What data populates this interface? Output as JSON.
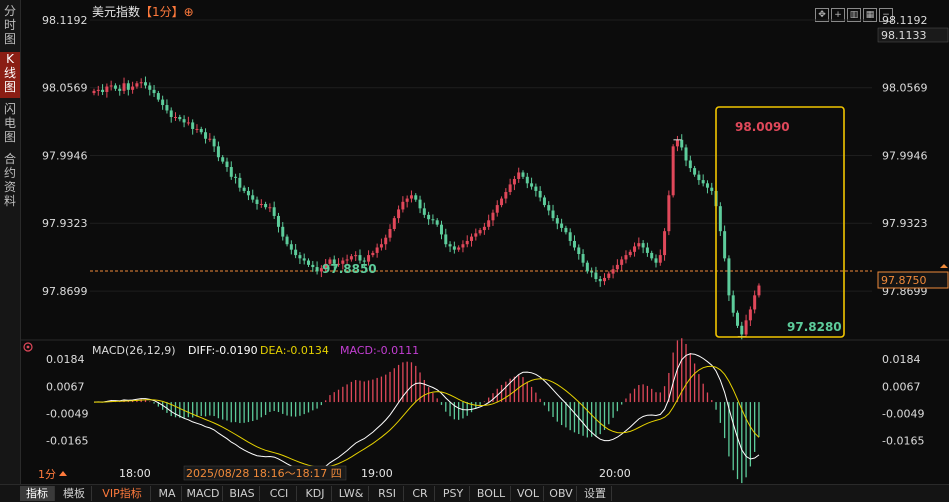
{
  "sidebar": {
    "tabs": [
      {
        "label": "分时图",
        "active": false
      },
      {
        "label": "K线图",
        "active": true
      },
      {
        "label": "闪电图",
        "active": false
      },
      {
        "label": "合约资料",
        "active": false
      }
    ]
  },
  "header": {
    "title": "美元指数",
    "period": "【1分】",
    "period_icon": "⊕",
    "toolbar_icons": [
      "move-icon",
      "zoom-in-icon",
      "chart-type-icon",
      "grid-icon",
      "zoom-out-icon"
    ]
  },
  "price_axis": {
    "ticks": [
      "98.1192",
      "98.0569",
      "97.9946",
      "97.9323",
      "97.8699"
    ],
    "current_price": "98.1133",
    "last_price_label": "97.8750"
  },
  "annotations": {
    "high_label": "98.0090",
    "low_label": "97.8280",
    "left_low_label": "97.8850"
  },
  "macd": {
    "header_params": "MACD(26,12,9)",
    "diff": "DIFF:-0.0190",
    "dea": "DEA:-0.0134",
    "macd": "MACD:-0.0111",
    "ticks": [
      "0.0184",
      "0.0067",
      "-0.0049",
      "-0.0165"
    ]
  },
  "time_axis": {
    "period_label": "1分",
    "ticks": [
      "18:00",
      "19:00",
      "20:00"
    ],
    "crosshair_range": "2025/08/28 18:16～18:17 四"
  },
  "footer": {
    "tabs": [
      "指标",
      "模板",
      "VIP指标",
      "MA",
      "MACD",
      "BIAS",
      "CCI",
      "KDJ",
      "LW&",
      "RSI",
      "CR",
      "PSY",
      "BOLL",
      "VOL",
      "OBV",
      "设置"
    ]
  },
  "colors": {
    "up": "#e0485a",
    "down": "#5dcc9b",
    "diff": "#ffffff",
    "dea": "#e6d200",
    "macd": "#c43fd4",
    "highlight_box": "#f2c500",
    "reference_line": "#f08a3a"
  },
  "chart_data": [
    {
      "type": "candlestick",
      "title": "美元指数 【1分】",
      "ylim": [
        97.8286,
        98.1192
      ],
      "reference_line": 97.875,
      "annotations": [
        {
          "label": "98.0090",
          "value": 98.009
        },
        {
          "label": "97.8280",
          "value": 97.828
        },
        {
          "label": "97.8850",
          "value": 97.885
        }
      ],
      "x_ticks": [
        "18:00",
        "19:00",
        "20:00"
      ],
      "series": [
        {
          "close": [
            98.054,
            98.055,
            98.053,
            98.058,
            98.059,
            98.056,
            98.054,
            98.061,
            98.055,
            98.058,
            98.061,
            98.062,
            98.059,
            98.055,
            98.052,
            98.046,
            98.041,
            98.036,
            98.03,
            98.03,
            98.028,
            98.025,
            98.025,
            98.019,
            98.019,
            98.016,
            98.01,
            98.01,
            98.003,
            97.993,
            97.989,
            97.984,
            97.975,
            97.974,
            97.965,
            97.962,
            97.958,
            97.954,
            97.95,
            97.95,
            97.947,
            97.947,
            97.939,
            97.929,
            97.92,
            97.913,
            97.908,
            97.903,
            97.9,
            97.898,
            97.894,
            97.892,
            97.888,
            97.891,
            97.895,
            97.899,
            97.895,
            97.895,
            97.898,
            97.899,
            97.902,
            97.903,
            97.898,
            97.897,
            97.903,
            97.905,
            97.91,
            97.913,
            97.919,
            97.927,
            97.937,
            97.945,
            97.952,
            97.955,
            97.958,
            97.954,
            97.946,
            97.94,
            97.936,
            97.935,
            97.931,
            97.922,
            97.913,
            97.911,
            97.908,
            97.91,
            97.913,
            97.916,
            97.92,
            97.923,
            97.926,
            97.929,
            97.935,
            97.942,
            97.949,
            97.955,
            97.961,
            97.968,
            97.973,
            97.979,
            97.975,
            97.969,
            97.966,
            97.962,
            97.956,
            97.949,
            97.944,
            97.937,
            97.932,
            97.928,
            97.924,
            97.916,
            97.91,
            97.904,
            97.896,
            97.888,
            97.887,
            97.881,
            97.879,
            97.882,
            97.886,
            97.89,
            97.894,
            97.899,
            97.903,
            97.906,
            97.911,
            97.914,
            97.91,
            97.905,
            97.9,
            97.896,
            97.903,
            97.925,
            97.958,
            98.003,
            98.009,
            98.002,
            97.99,
            97.983,
            97.977,
            97.972,
            97.969,
            97.965,
            97.962,
            97.948,
            97.925,
            97.9,
            97.866,
            97.85,
            97.838,
            97.83,
            97.843,
            97.853,
            97.866,
            97.875
          ]
        }
      ]
    },
    {
      "type": "line",
      "title": "MACD(26,12,9)",
      "ylim": [
        -0.0256,
        0.0184
      ],
      "y_ticks": [
        "0.0184",
        "0.0067",
        "-0.0049",
        "-0.0165"
      ],
      "series": [
        {
          "name": "DIFF"
        },
        {
          "name": "DEA"
        },
        {
          "name": "MACD"
        }
      ]
    }
  ]
}
